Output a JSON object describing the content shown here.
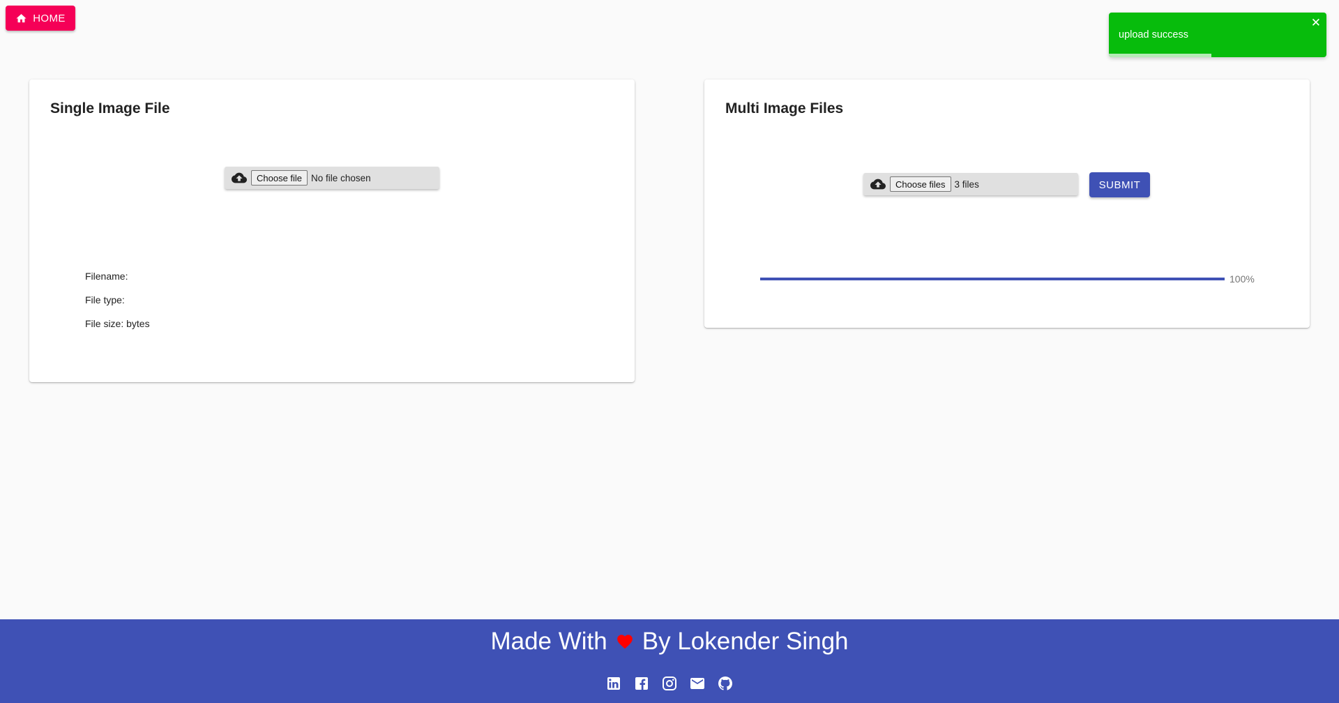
{
  "nav": {
    "home_label": "HOME",
    "home_icon": "home-icon"
  },
  "toast": {
    "message": "upload success",
    "close": "✕",
    "color": "#07bc0c",
    "remaining_fraction": 0.47
  },
  "single": {
    "title": "Single Image File",
    "choose_label": "Choose file",
    "status": "No file chosen",
    "filename_label": "Filename:",
    "filetype_label": "File type:",
    "filesize_label": "File size: bytes"
  },
  "multi": {
    "title": "Multi Image Files",
    "choose_label": "Choose files",
    "status": "3 files",
    "submit_label": "SUBMIT",
    "progress_percent": 100,
    "progress_label": "100%"
  },
  "footer": {
    "made_with": "Made With",
    "by_author": "By Lokender Singh",
    "social_icons": [
      "linkedin-icon",
      "facebook-icon",
      "instagram-icon",
      "email-icon",
      "github-icon"
    ]
  },
  "colors": {
    "primary": "#3f51b5",
    "accent": "#f50057",
    "success": "#07bc0c",
    "heart": "#ff0000"
  }
}
